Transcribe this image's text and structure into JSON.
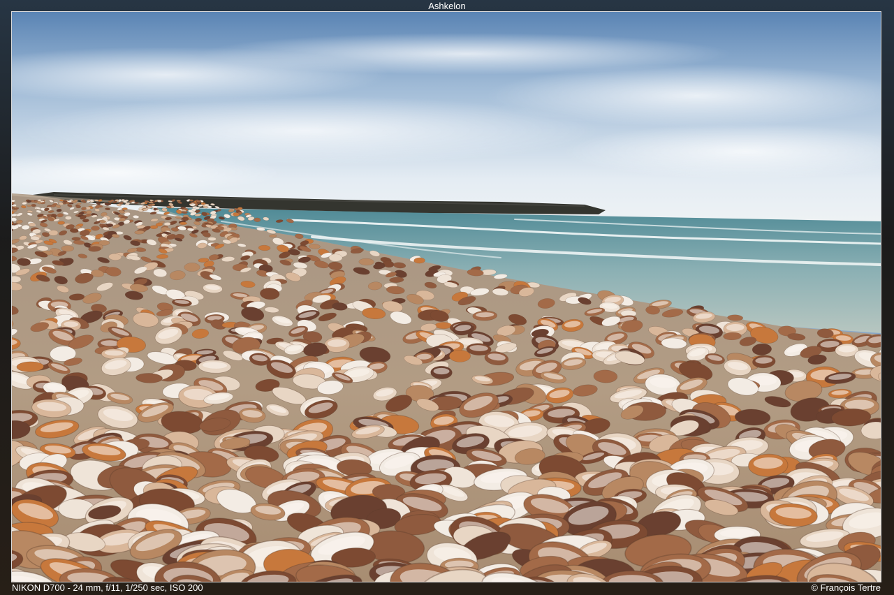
{
  "title": "Ashkelon",
  "exif": "NIKON D700 - 24 mm, f/11, 1/250 sec, ISO 200",
  "credit": "© François Tertre",
  "colors": {
    "sky_top": "#5f86b3",
    "sky_bottom": "#e6edf3",
    "sea": "#6f9aa4",
    "sand": "#b09a82",
    "shell_light": "#efe3d6",
    "shell_brown": "#9a6a4a",
    "shell_orange": "#c9783a",
    "breakwater": "#3a3a36"
  }
}
